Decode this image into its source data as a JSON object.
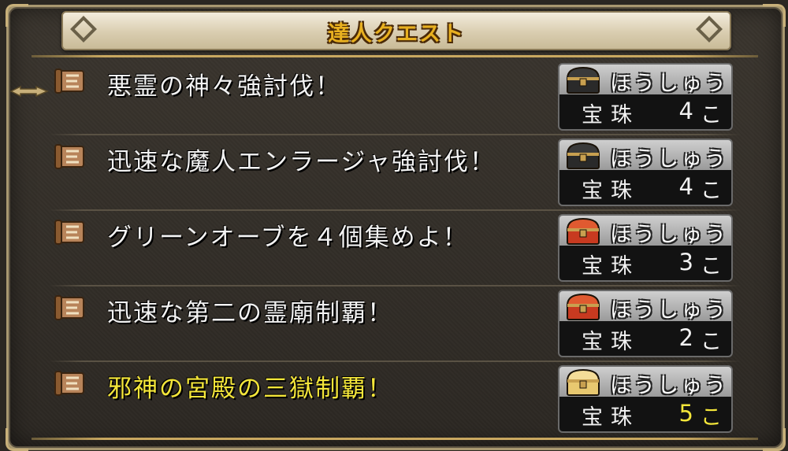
{
  "window": {
    "title": "達人クエスト"
  },
  "reward_header_label": "ほうしゅう",
  "quests": [
    {
      "name": "悪霊の神々強討伐！",
      "reward_item": "宝珠",
      "reward_count": "4",
      "reward_unit": "こ",
      "chest_style": "black-chest-icon",
      "highlight": false,
      "selected": true
    },
    {
      "name": "迅速な魔人エンラージャ強討伐！",
      "reward_item": "宝珠",
      "reward_count": "4",
      "reward_unit": "こ",
      "chest_style": "black-chest-icon",
      "highlight": false,
      "selected": false
    },
    {
      "name": "グリーンオーブを４個集めよ！",
      "reward_item": "宝珠",
      "reward_count": "3",
      "reward_unit": "こ",
      "chest_style": "red-chest-icon",
      "highlight": false,
      "selected": false
    },
    {
      "name": "迅速な第二の霊廟制覇！",
      "reward_item": "宝珠",
      "reward_count": "2",
      "reward_unit": "こ",
      "chest_style": "red-chest-icon",
      "highlight": false,
      "selected": false
    },
    {
      "name": "邪神の宮殿の三獄制覇！",
      "reward_item": "宝珠",
      "reward_count": "5",
      "reward_unit": "こ",
      "chest_style": "gold-chest-icon",
      "highlight": true,
      "selected": false
    }
  ],
  "colors": {
    "highlight_text": "#f4e63a",
    "title_text": "#e8b020",
    "black_chest": "#2a2a2a",
    "red_chest": "#c83a20",
    "gold_chest": "#e8c870"
  }
}
